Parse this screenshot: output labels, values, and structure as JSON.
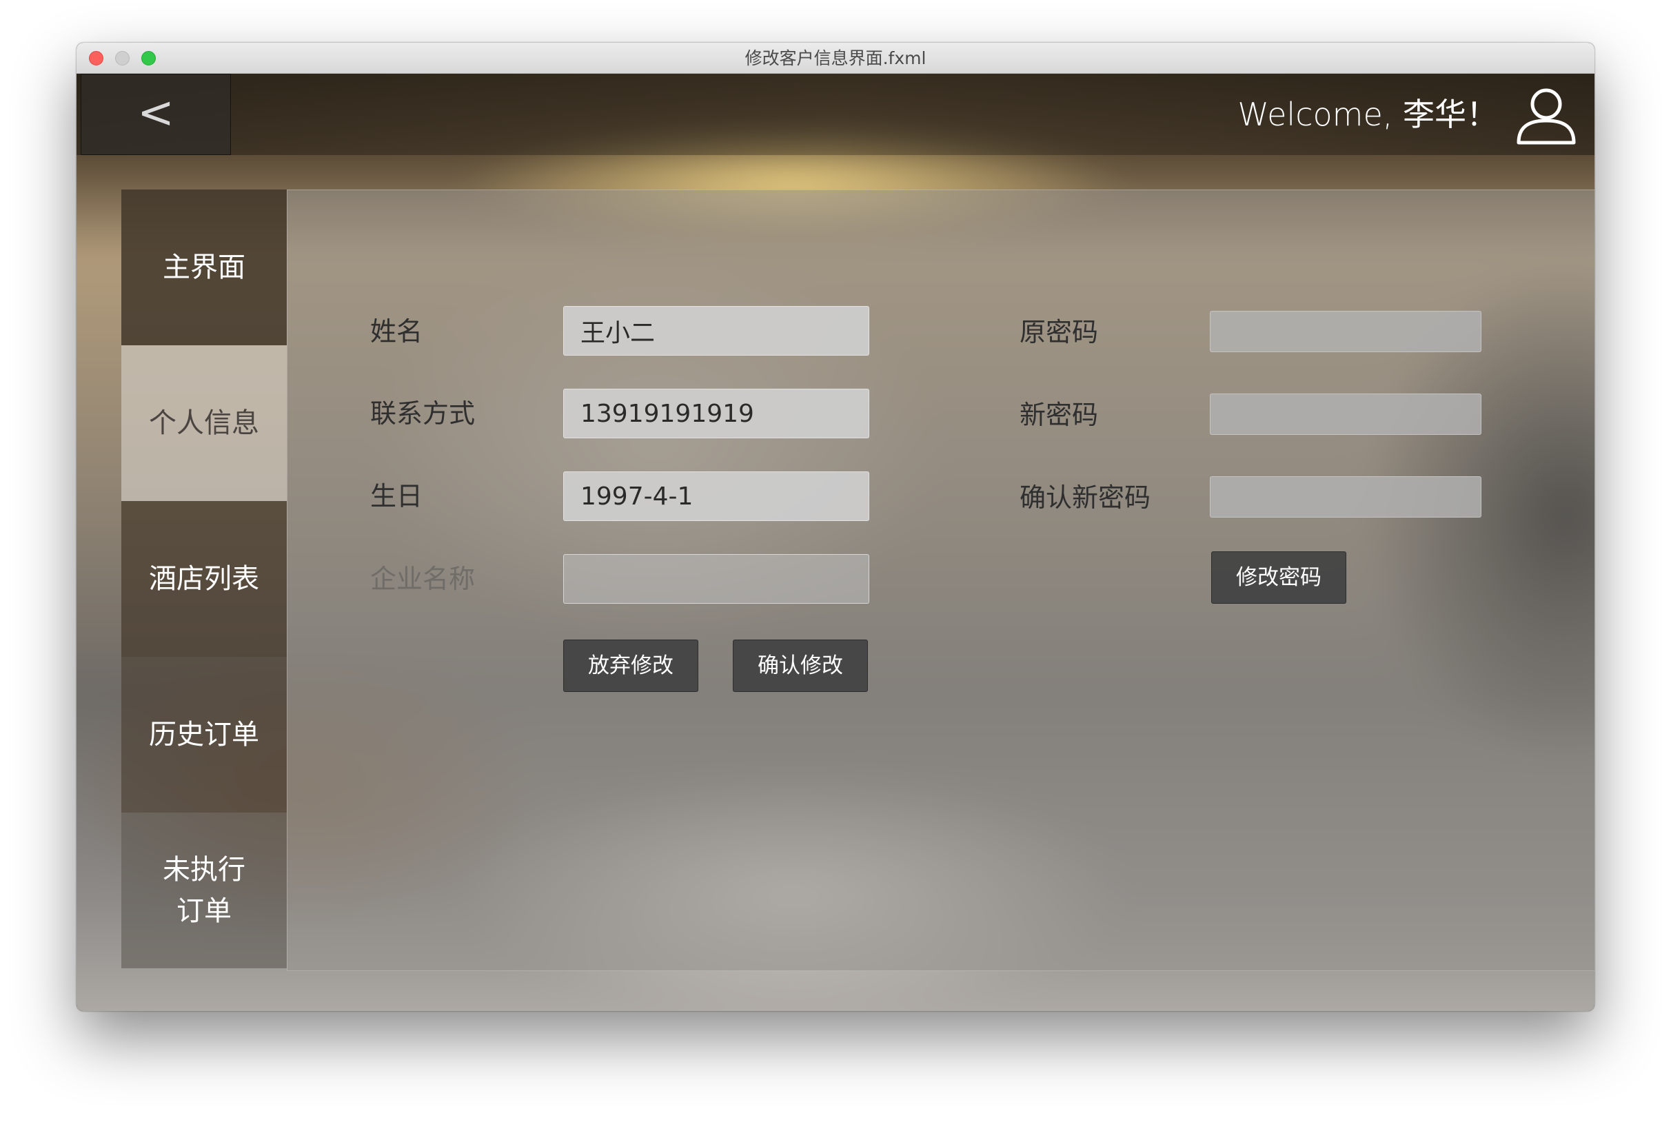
{
  "window": {
    "title": "修改客户信息界面.fxml"
  },
  "header": {
    "back_label": "<",
    "welcome": "Welcome, 李华！",
    "user_icon": "user-icon"
  },
  "sidebar": {
    "items": [
      {
        "label": "主界面"
      },
      {
        "label": "个人信息",
        "selected": true
      },
      {
        "label": "酒店列表"
      },
      {
        "label": "历史订单"
      },
      {
        "label": "未执行\n订单"
      }
    ]
  },
  "form": {
    "name_label": "姓名",
    "name_value": "王小二",
    "phone_label": "联系方式",
    "phone_value": "13919191919",
    "birthday_label": "生日",
    "birthday_value": "1997-4-1",
    "company_label": "企业名称",
    "company_value": "",
    "cancel_button": "放弃修改",
    "confirm_button": "确认修改"
  },
  "password": {
    "old_label": "原密码",
    "new_label": "新密码",
    "confirm_label": "确认新密码",
    "change_button": "修改密码"
  },
  "colors": {
    "button_bg": "#424242",
    "field_bg": "#cecece"
  }
}
